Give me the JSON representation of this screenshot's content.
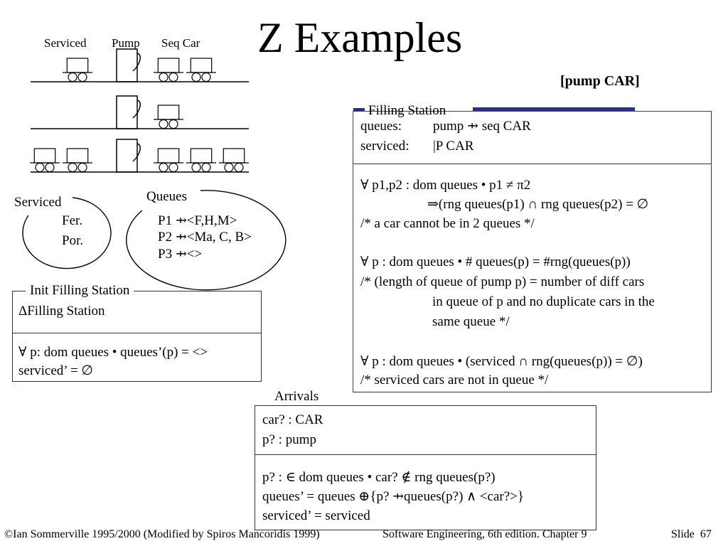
{
  "slide": {
    "title": "Z Examples",
    "given_sets": "[pump CAR]"
  },
  "diagram": {
    "labels": {
      "serviced": "Serviced",
      "pump": "Pump",
      "seq_car": "Seq Car"
    },
    "rows": [
      {
        "serviced_cars": 1,
        "queued_cars": 2
      },
      {
        "serviced_cars": 0,
        "queued_cars": 1
      },
      {
        "serviced_cars": 2,
        "queued_cars": 3
      }
    ],
    "serviced_set": {
      "label": "Serviced",
      "items": [
        "Fer.",
        "Por."
      ]
    },
    "queues_set": {
      "label": "Queues",
      "items": [
        "P1 ⇸<F,H,M>",
        "P2 ⇸<Ma, C, B>",
        "P3 ⇸<>"
      ]
    }
  },
  "filling_station": {
    "name": "Filling Station",
    "declarations": [
      {
        "name": "queues:",
        "type": "pump ⇸ seq CAR"
      },
      {
        "name": "serviced:",
        "type": "|P CAR"
      }
    ],
    "predicates": [
      "∀ p1,p2 : dom queues • p1 ≠ π2",
      "⇒(rng queues(p1) ∩ rng queues(p2) = ∅",
      "/* a car cannot be in 2 queues */",
      "",
      "∀ p : dom queues • # queues(p) = #rng(queues(p))",
      "/* (length of queue of pump p) = number of diff cars",
      "in queue of p and no duplicate cars in the",
      "same queue */",
      "",
      "∀ p : dom queues • (serviced ∩ rng(queues(p)) = ∅)",
      "/* serviced cars are not in queue */"
    ],
    "accent_color": "#2c2c8c"
  },
  "init_filling_station": {
    "name": "Init Filling Station",
    "declarations": [
      "ΔFilling Station"
    ],
    "predicates": [
      "∀ p: dom queues • queues’(p) = <>",
      "serviced’ = ∅"
    ]
  },
  "arrivals": {
    "name": "Arrivals",
    "declarations": [
      "car? : CAR",
      "p? : pump"
    ],
    "predicates": [
      "p? : ∈ dom queues • car? ∉ rng queues(p?)",
      "queues’ = queues ⊕{p? ⇸queues(p?) ∧ <car?>}",
      "serviced’ = serviced"
    ]
  },
  "footer": {
    "copyright": "©Ian Sommerville 1995/2000 (Modified by Spiros Mancoridis 1999)",
    "book": "Software Engineering, 6th edition. Chapter 9",
    "slide_label": "Slide",
    "slide_number": "67"
  }
}
